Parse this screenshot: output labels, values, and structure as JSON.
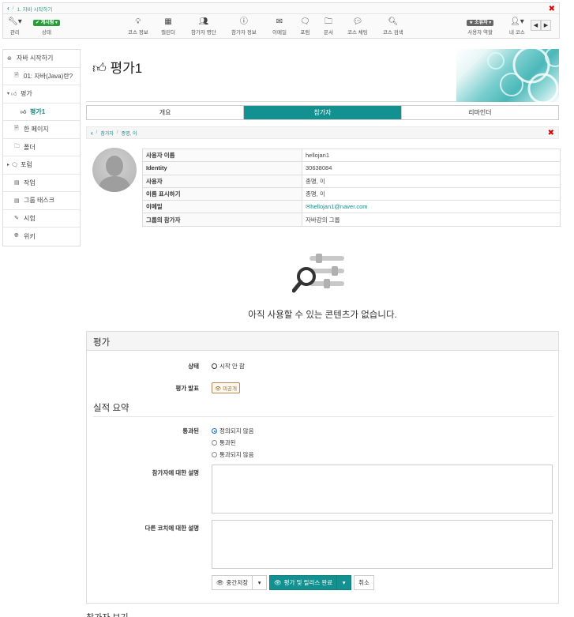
{
  "breadcrumb_top": {
    "parent": "1. 자바 시작하기"
  },
  "toolbar": {
    "admin_label": "관리",
    "status_badge": "게시됨",
    "status_label": "상태",
    "items": [
      {
        "label": "코스 정보",
        "icon": "lightbulb-icon"
      },
      {
        "label": "캘린더",
        "icon": "calendar-icon"
      },
      {
        "label": "참가자 명단",
        "icon": "users-icon"
      },
      {
        "label": "참가자 정보",
        "icon": "info-icon"
      },
      {
        "label": "이메일",
        "icon": "envelope-icon"
      },
      {
        "label": "포럼",
        "icon": "chat-icon"
      },
      {
        "label": "문서",
        "icon": "folder-icon"
      },
      {
        "label": "코스 채팅",
        "icon": "bubble-icon"
      },
      {
        "label": "코스 검색",
        "icon": "search-icon"
      }
    ],
    "role_badge": "소유자",
    "role_label": "사용자 역할",
    "my_courses_label": "내 코스"
  },
  "sidebar": {
    "items": [
      {
        "label": "자바 시작하기",
        "icon": "course-icon"
      },
      {
        "label": "01: 자바(Java)란?",
        "icon": "page-icon"
      },
      {
        "label": "평가",
        "icon": "thumbsup-icon"
      },
      {
        "label": "평가1",
        "icon": "thumbsup-icon"
      },
      {
        "label": "한 페이지",
        "icon": "page-icon"
      },
      {
        "label": "폴더",
        "icon": "folder-icon"
      },
      {
        "label": "포럼",
        "icon": "chat-icon"
      },
      {
        "label": "작업",
        "icon": "task-icon"
      },
      {
        "label": "그룹 태스크",
        "icon": "task-icon"
      },
      {
        "label": "시험",
        "icon": "edit-icon"
      },
      {
        "label": "위키",
        "icon": "globe-icon"
      }
    ]
  },
  "page": {
    "title": "평가1",
    "tabs": [
      "개요",
      "참가자",
      "리마인더"
    ],
    "active_tab": 1
  },
  "breadcrumb2": {
    "first": "참가자",
    "second": "종명, 이"
  },
  "profile": {
    "rows": [
      {
        "key": "사용자 이름",
        "value": "hellojan1"
      },
      {
        "key": "Identity",
        "value": "30638084"
      },
      {
        "key": "사용자",
        "value": "종명, 이"
      },
      {
        "key": "이름 표시하기",
        "value": "종명, 이"
      },
      {
        "key": "이메일",
        "value": "hellojan1@naver.com"
      },
      {
        "key": "그룹의 참가자",
        "value": "자바강의 그룹"
      }
    ]
  },
  "empty": {
    "message": "아직 사용할 수 있는 콘텐츠가 없습니다."
  },
  "assessment": {
    "title": "평가",
    "status_label": "상태",
    "status_value": "시작 안 함",
    "release_label": "평가 발표",
    "release_value": "미공개",
    "summary_title": "실적 요약",
    "passed_label": "통과된",
    "passed_options": [
      "정의되지 않음",
      "통과된",
      "통과되지 않음"
    ],
    "passed_selected": 0,
    "comment_label": "참가자에 대한 설명",
    "coach_comment_label": "다른 코치에 대한 설명",
    "btn_save": "중간저장",
    "btn_complete": "평가 및 릴리스 완료",
    "btn_cancel": "취소"
  },
  "footer": {
    "text": "참가자 보기"
  },
  "colors": {
    "accent": "#139090",
    "close": "#d00000",
    "badge_green": "#2a9d3a"
  }
}
